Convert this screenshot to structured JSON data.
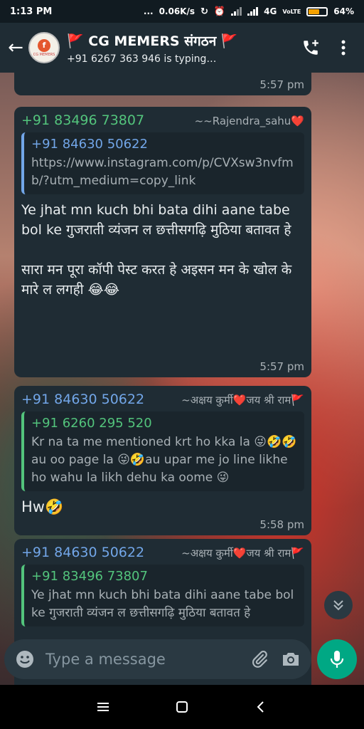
{
  "status_bar": {
    "time": "1:13 PM",
    "dots": "...",
    "net_speed": "0.06K/s",
    "network": "4G",
    "volte": "VoLTE",
    "battery": "64%",
    "battery_level": 0.64
  },
  "header": {
    "group_name": "🚩 CG MEMERS संगठन 🚩",
    "typing_status": "+91 6267 363 946 is typing…",
    "avatar_letter": "f",
    "avatar_caption": "CG MEMERS"
  },
  "messages": [
    {
      "time": "5:57 pm"
    },
    {
      "sender_number": "+91 83496 73807",
      "sender_alias": "~~Rajendra_sahu❤️",
      "quote_name": "+91 84630 50622",
      "quote_text": "https://www.instagram.com/p/CVXsw3nvfmb/?utm_medium=copy_link",
      "text": "Ye jhat mn kuch bhi  bata dihi aane tabe bol ke गुजराती व्यंजन ल  छत्तीसगढ़ि मुठिया बतावत हे\n\nसारा मन पूरा कॉपी पेस्ट करत हे अइसन मन के खोल के मारे ल लगही 😂😂",
      "time": "5:57 pm"
    },
    {
      "sender_number": "+91 84630 50622",
      "sender_alias": "~अक्षय कुर्मी❤️जय श्री राम🚩",
      "quote_name": "+91 6260 295 520",
      "quote_text": "Kr na ta me mentioned krt ho kka la 😜🤣🤣 au oo page la 😜🤣au upar me jo line likhe ho wahu la likh dehu ka oome 😜",
      "text": "Hw🤣",
      "time": "5:58 pm"
    },
    {
      "sender_number": "+91 84630 50622",
      "sender_alias": "~अक्षय कुर्मी❤️जय श्री राम🚩",
      "quote_name": "+91 83496 73807",
      "quote_text": "Ye jhat mn kuch bhi  bata dihi aane tabe bol ke गुजराती व्यंजन ल  छत्तीसगढ़ि मुठिया बतावत हे"
    }
  ],
  "composer": {
    "placeholder": "Type a message"
  },
  "colors": {
    "header_bg": "#1f2c34",
    "bubble_bg": "#1f2c34",
    "sender_green": "#53c47c",
    "sender_blue": "#72a6e8",
    "mic_button": "#00a884",
    "battery_fill": "#f4a100"
  },
  "icons": {
    "back": "arrow-left-icon",
    "add_call": "phone-plus-icon",
    "menu": "more-vertical-icon",
    "emoji": "emoji-icon",
    "attach": "paperclip-icon",
    "camera": "camera-icon",
    "mic": "mic-icon",
    "scroll_down": "double-chevron-down-icon",
    "nav_menu": "hamburger-icon",
    "nav_home": "square-icon",
    "nav_back": "chevron-left-icon"
  }
}
